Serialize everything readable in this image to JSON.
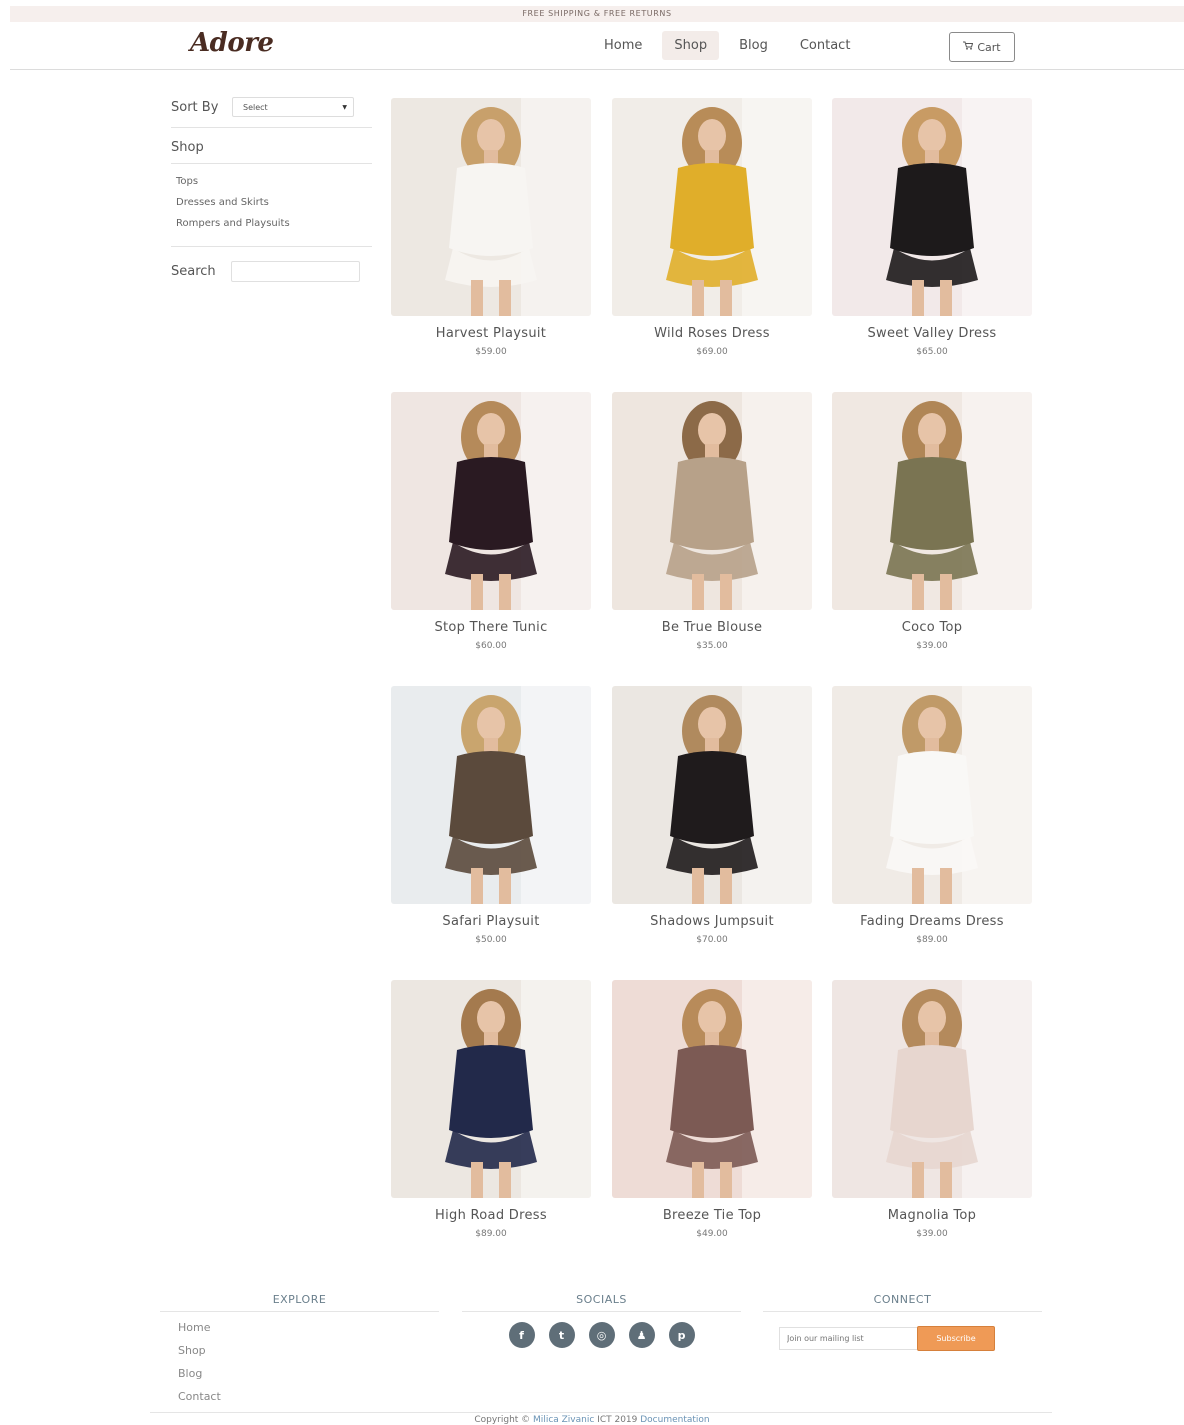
{
  "topbar": {
    "text": "FREE SHIPPING & FREE RETURNS"
  },
  "header": {
    "logo": "Adore",
    "nav": [
      {
        "label": "Home",
        "active": false
      },
      {
        "label": "Shop",
        "active": true
      },
      {
        "label": "Blog",
        "active": false
      },
      {
        "label": "Contact",
        "active": false
      }
    ],
    "cart_label": "Cart",
    "cart_icon": "shopping-cart-icon"
  },
  "sidebar": {
    "sort_label": "Sort By",
    "sort_value": "Select",
    "shop_heading": "Shop",
    "categories": [
      "Tops",
      "Dresses and Skirts",
      "Rompers and Playsuits"
    ],
    "search_label": "Search",
    "search_value": ""
  },
  "products": [
    {
      "name": "Harvest Playsuit",
      "price": "$59.00",
      "bg": "#ede8e2",
      "outfit": "#f7f5f2",
      "hair": "#c8a06b"
    },
    {
      "name": "Wild Roses Dress",
      "price": "$69.00",
      "bg": "#f1ede8",
      "outfit": "#e0ae2a",
      "hair": "#b88c58"
    },
    {
      "name": "Sweet Valley Dress",
      "price": "$65.00",
      "bg": "#f2e9e9",
      "outfit": "#1d1a1b",
      "hair": "#c89b64"
    },
    {
      "name": "Stop There Tunic",
      "price": "$60.00",
      "bg": "#efe6e2",
      "outfit": "#2a1a22",
      "hair": "#b58a5a"
    },
    {
      "name": "Be True Blouse",
      "price": "$35.00",
      "bg": "#eee6df",
      "outfit": "#b7a189",
      "hair": "#8c6a48"
    },
    {
      "name": "Coco Top",
      "price": "$39.00",
      "bg": "#f0e8e2",
      "outfit": "#7a7452",
      "hair": "#b08656"
    },
    {
      "name": "Safari Playsuit",
      "price": "$50.00",
      "bg": "#e9ecee",
      "outfit": "#5b4a3c",
      "hair": "#c9a56e"
    },
    {
      "name": "Shadows Jumpsuit",
      "price": "$70.00",
      "bg": "#ebe7e2",
      "outfit": "#1f1b1c",
      "hair": "#b08a5e"
    },
    {
      "name": "Fading Dreams Dress",
      "price": "$89.00",
      "bg": "#f0ebe6",
      "outfit": "#f9f8f6",
      "hair": "#c09a68"
    },
    {
      "name": "High Road Dress",
      "price": "$89.00",
      "bg": "#ece7e1",
      "outfit": "#22294a",
      "hair": "#a47a4e"
    },
    {
      "name": "Breeze Tie Top",
      "price": "$49.00",
      "bg": "#eedcd6",
      "outfit": "#7c5a54",
      "hair": "#b88b5a"
    },
    {
      "name": "Magnolia Top",
      "price": "$39.00",
      "bg": "#efe6e3",
      "outfit": "#e7d6cf",
      "hair": "#b48a5c"
    }
  ],
  "footer": {
    "explore_heading": "EXPLORE",
    "explore_links": [
      "Home",
      "Shop",
      "Blog",
      "Contact"
    ],
    "socials_heading": "SOCIALS",
    "socials": [
      {
        "name": "facebook-icon",
        "glyph": "f"
      },
      {
        "name": "twitter-icon",
        "glyph": "t"
      },
      {
        "name": "instagram-icon",
        "glyph": "◎"
      },
      {
        "name": "snapchat-icon",
        "glyph": "♟"
      },
      {
        "name": "pinterest-icon",
        "glyph": "p"
      }
    ],
    "connect_heading": "CONNECT",
    "mailing_placeholder": "Join our mailing list",
    "subscribe_label": "Subscribe",
    "copyright_prefix": "Copyright © ",
    "copyright_author": "Milica Zivanic",
    "copyright_middle": " ICT 2019 ",
    "copyright_doc": "Documentation"
  }
}
